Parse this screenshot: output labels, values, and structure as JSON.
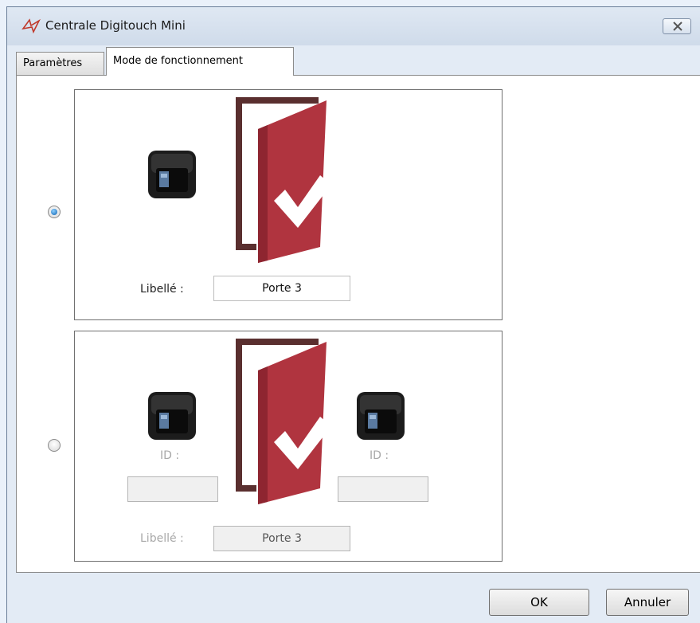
{
  "window": {
    "title": "Centrale Digitouch Mini"
  },
  "tabs": [
    {
      "label": "Paramètres",
      "active": false
    },
    {
      "label": "Mode de fonctionnement",
      "active": true
    }
  ],
  "options": [
    {
      "selected": true,
      "libelle_label": "Libellé :",
      "libelle_value": "Porte 3"
    },
    {
      "selected": false,
      "id_left_label": "ID :",
      "id_left_value": "",
      "id_right_label": "ID :",
      "id_right_value": "",
      "libelle_label": "Libellé :",
      "libelle_value": "Porte 3"
    }
  ],
  "buttons": {
    "ok": "OK",
    "cancel": "Annuler"
  },
  "colors": {
    "door": "#b0343f",
    "frame": "#5a2f2f",
    "accent": "#0a5fb0"
  },
  "icons": [
    "app-logo-icon",
    "close-icon",
    "fingerprint-reader-icon",
    "door-open-check-icon"
  ]
}
